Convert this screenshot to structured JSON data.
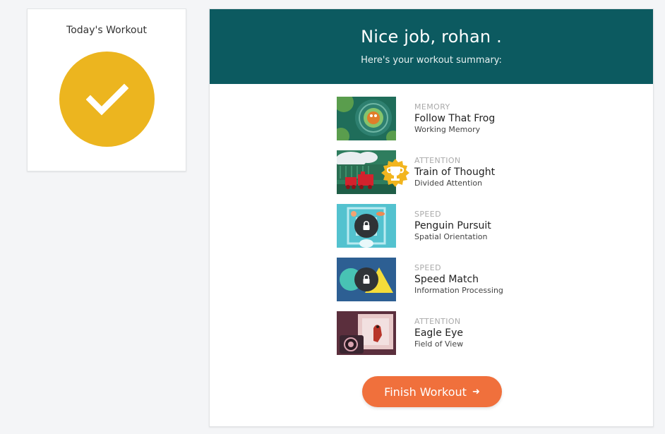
{
  "sidebar": {
    "title": "Today's Workout",
    "status_icon": "checkmark-icon",
    "badge_color": "#ecb51f"
  },
  "header": {
    "greeting": "Nice job, rohan .",
    "subtitle": "Here's your workout summary:",
    "background_color": "#0c5a60"
  },
  "games": [
    {
      "category": "MEMORY",
      "name": "Follow That Frog",
      "skill": "Working Memory",
      "status": "completed"
    },
    {
      "category": "ATTENTION",
      "name": "Train of Thought",
      "skill": "Divided Attention",
      "status": "trophy"
    },
    {
      "category": "SPEED",
      "name": "Penguin Pursuit",
      "skill": "Spatial Orientation",
      "status": "locked"
    },
    {
      "category": "SPEED",
      "name": "Speed Match",
      "skill": "Information Processing",
      "status": "locked"
    },
    {
      "category": "ATTENTION",
      "name": "Eagle Eye",
      "skill": "Field of View",
      "status": "completed"
    }
  ],
  "finish_button": {
    "label": "Finish Workout",
    "icon": "arrow-right-icon",
    "color": "#f0703c"
  }
}
